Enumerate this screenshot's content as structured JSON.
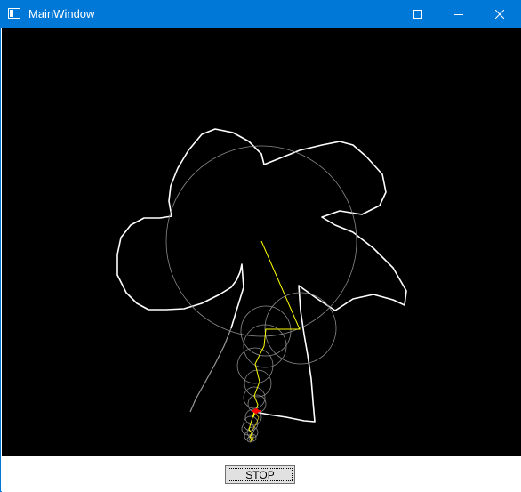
{
  "window": {
    "title": "MainWindow",
    "titlebar_color": "#0078d7",
    "controls": [
      "minimize-icon",
      "maximize-icon",
      "close-icon"
    ]
  },
  "canvas": {
    "background": "#000000",
    "traced_path_color": "#ffffff",
    "epicycle_circle_color": "#8a8a8a",
    "arm_color": "#ffff00",
    "pen_color": "#ff0000"
  },
  "footer": {
    "stop_label": "STOP"
  }
}
